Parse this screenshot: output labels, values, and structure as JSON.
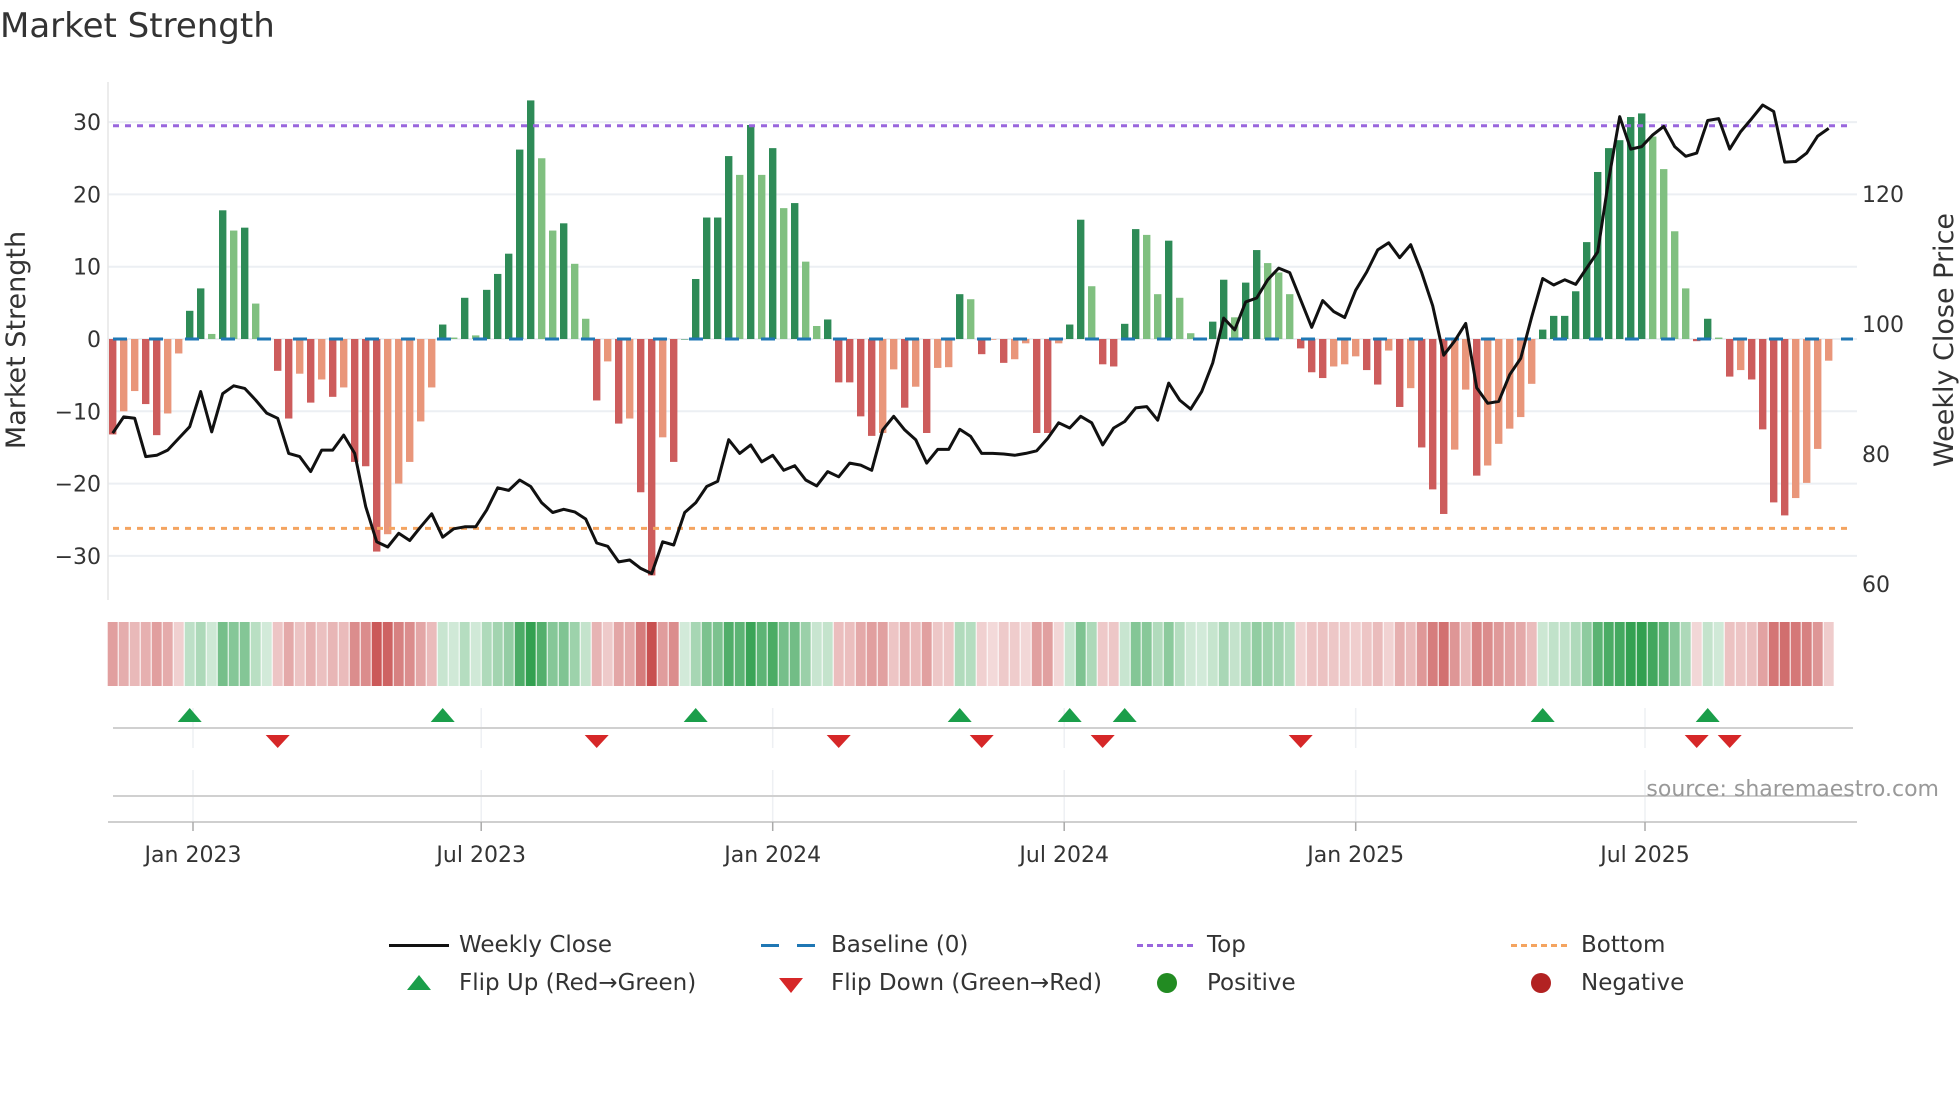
{
  "title": "Market Strength",
  "source": "source: sharemaestro.com",
  "legend": {
    "weekly_close": "Weekly Close",
    "baseline": "Baseline (0)",
    "top": "Top",
    "bottom": "Bottom",
    "flip_up": "Flip Up (Red→Green)",
    "flip_down": "Flip Down (Green→Red)",
    "positive": "Positive",
    "negative": "Negative"
  },
  "colors": {
    "pos_rising": "#2e8b57",
    "pos_falling": "#80c080",
    "neg_falling": "#cd5c5c",
    "neg_rising": "#e9967a",
    "line": "#111111",
    "baseline": "#1f77b4",
    "top": "#9966dd",
    "bottom": "#f4a460",
    "flip_up": "#1a9e4a",
    "flip_down": "#d62728",
    "positive": "#228b22",
    "negative": "#b22222",
    "grid": "#eceff3"
  },
  "chart_data": {
    "type": "bar",
    "title": "Market Strength",
    "ylabel": "Market Strength",
    "y2label": "Weekly Close Price",
    "xlabel": "",
    "ylim": [
      -36,
      35.5
    ],
    "y2lim": [
      60.9,
      140
    ],
    "yticks": [
      -30,
      -20,
      -10,
      0,
      10,
      20,
      30
    ],
    "ytick_labels": [
      "−30",
      "−20",
      "−10",
      "0",
      "10",
      "20",
      "30"
    ],
    "y2ticks": [
      60,
      80,
      100,
      120
    ],
    "y2tick_labels": [
      "60",
      "80",
      "100",
      "120"
    ],
    "xticks": [
      {
        "label": "Jan 2023",
        "week": 8.3
      },
      {
        "label": "Jul 2023",
        "week": 34.5
      },
      {
        "label": "Jan 2024",
        "week": 61
      },
      {
        "label": "Jul 2024",
        "week": 87.5
      },
      {
        "label": "Jan 2025",
        "week": 114
      },
      {
        "label": "Jul 2025",
        "week": 140.3
      }
    ],
    "top_level": 29.5,
    "bottom_level": -26.2,
    "baseline": 0,
    "strength": [
      -13.2,
      -10,
      -7.2,
      -9,
      -13.3,
      -10.3,
      -2,
      3.9,
      7,
      0.7,
      17.8,
      15,
      15.4,
      4.9,
      0,
      -4.4,
      -11,
      -4.8,
      -8.8,
      -5.6,
      -8,
      -6.7,
      -17,
      -17.6,
      -29.4,
      -27,
      -20,
      -17,
      -11.4,
      -6.7,
      2,
      0.2,
      5.7,
      0.5,
      6.8,
      9,
      11.8,
      26.2,
      33,
      25,
      15,
      16,
      10.4,
      2.8,
      -8.5,
      -3.1,
      -11.7,
      -11,
      -21.2,
      -32.7,
      -13.6,
      -17,
      0,
      8.3,
      16.8,
      16.8,
      25.3,
      22.7,
      29.6,
      22.7,
      26.4,
      18.1,
      18.8,
      10.7,
      1.8,
      2.7,
      -6,
      -6,
      -10.7,
      -13.4,
      -13,
      -4.2,
      -9.5,
      -6.6,
      -13,
      -4,
      -3.9,
      6.2,
      5.5,
      -2.1,
      -0.1,
      -3.3,
      -2.8,
      -0.6,
      -13,
      -13,
      -0.6,
      2,
      16.5,
      7.3,
      -3.5,
      -3.8,
      2.1,
      15.2,
      14.4,
      6.2,
      13.6,
      5.7,
      0.8,
      0,
      2.4,
      8.2,
      3,
      7.8,
      12.3,
      10.5,
      9.2,
      6.2,
      -1.3,
      -4.6,
      -5.4,
      -3.8,
      -3.5,
      -2.4,
      -4.3,
      -6.3,
      -1.6,
      -9.4,
      -6.8,
      -15,
      -20.8,
      -24.2,
      -15.3,
      -7,
      -18.9,
      -17.5,
      -14.5,
      -12.4,
      -10.8,
      -6.2,
      1.3,
      3.2,
      3.2,
      6.6,
      13.4,
      23.1,
      26.4,
      27.5,
      30.7,
      31.2,
      28,
      23.5,
      14.9,
      7,
      -0.3,
      2.8,
      0.2,
      -5.2,
      -4.3,
      -5.6,
      -12.5,
      -22.6,
      -24.4,
      -22,
      -19.9,
      -15.2,
      -3
    ],
    "weekly_close": [
      83.2,
      85.7,
      85.5,
      79.6,
      79.8,
      80.6,
      82.4,
      84.2,
      89.6,
      83.4,
      89.3,
      90.5,
      90.1,
      88.3,
      86.3,
      85.5,
      80.1,
      79.6,
      77.3,
      80.6,
      80.6,
      82.9,
      80.1,
      71.9,
      66.5,
      65.7,
      67.8,
      66.7,
      68.8,
      70.8,
      67.2,
      68.5,
      68.8,
      68.8,
      71.4,
      74.8,
      74.4,
      76,
      75,
      72.5,
      71,
      71.5,
      71.1,
      70,
      66.3,
      65.8,
      63.4,
      63.7,
      62.4,
      61.6,
      66.5,
      66,
      71,
      72.5,
      75,
      75.8,
      82.2,
      80.1,
      81.4,
      78.8,
      79.8,
      77.5,
      78.2,
      76,
      75.1,
      77.3,
      76.5,
      78.6,
      78.3,
      77.5,
      83.7,
      85.8,
      83.7,
      82.2,
      78.6,
      80.7,
      80.7,
      83.8,
      82.7,
      80.1,
      80.1,
      80,
      79.8,
      80.1,
      80.5,
      82.4,
      84.8,
      84,
      85.8,
      84.8,
      81.4,
      84,
      85,
      87.1,
      87.3,
      85.2,
      90.9,
      88.3,
      86.9,
      89.6,
      94,
      100.9,
      99.1,
      103.4,
      104,
      106.8,
      108.6,
      107.9,
      103.7,
      99.5,
      103.6,
      101.9,
      101,
      105.2,
      108,
      111.4,
      112.5,
      110.2,
      112.2,
      107.9,
      102.8,
      95.2,
      97.4,
      100.1,
      90.2,
      87.8,
      88.1,
      92.2,
      94.7,
      101.1,
      107,
      106,
      106.8,
      106.1,
      108.6,
      111.1,
      122.2,
      131.9,
      126.9,
      127.3,
      129.1,
      130.4,
      127.3,
      125.8,
      126.3,
      131.3,
      131.6,
      126.9,
      129.6,
      131.6,
      133.7,
      132.7,
      124.9,
      125,
      126.3,
      128.9,
      130.1
    ],
    "flip_up_weeks": [
      8,
      31,
      54,
      78,
      88,
      93,
      131,
      146
    ],
    "flip_down_weeks": [
      16,
      45,
      67,
      80,
      91,
      109,
      145,
      148
    ]
  }
}
